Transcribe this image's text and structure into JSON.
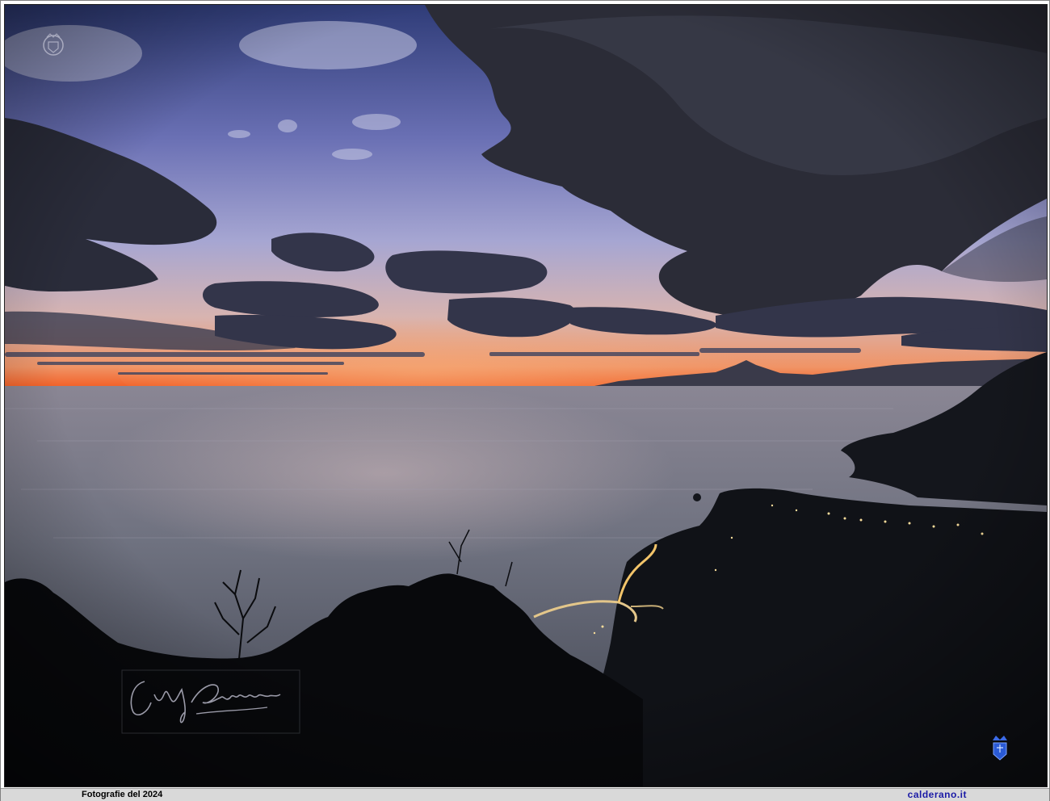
{
  "photo": {
    "subject": "",
    "colors": {
      "sky_top": "#3c4a86",
      "sky_mid": "#8b8fc4",
      "sky_horizon": "#e8a37a",
      "sunset_band": "#f26a2a",
      "sea": "#6f7281",
      "cloud_dark": "#2a2c38",
      "land": "#0d0e12"
    },
    "signature": "Ciccio Calderano",
    "watermark_logo": "crest-logo"
  },
  "footer": {
    "left_text": "Fotografie del 2024",
    "right_text": "calderano.it"
  }
}
